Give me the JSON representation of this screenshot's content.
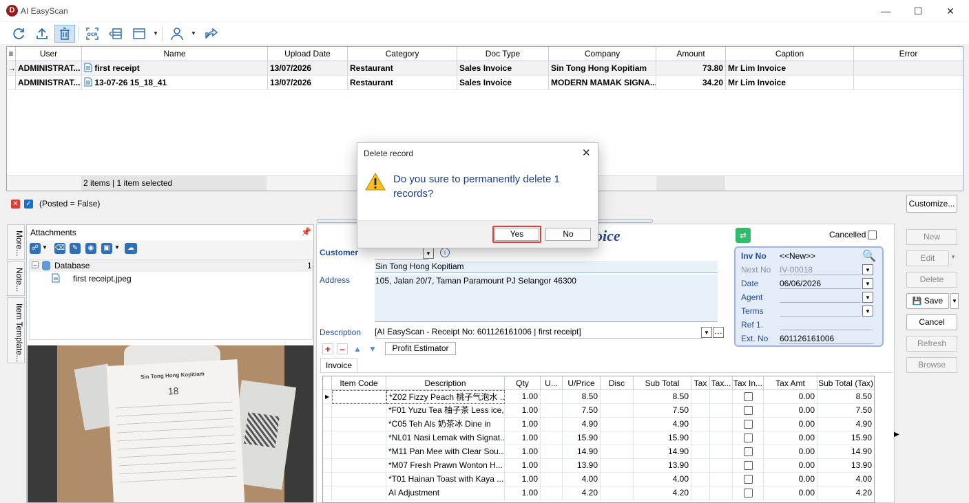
{
  "app": {
    "title": "AI EasyScan",
    "logo_letter": "D"
  },
  "grid": {
    "columns": [
      "User",
      "Name",
      "Upload Date",
      "Category",
      "Doc Type",
      "Company",
      "Amount",
      "Caption",
      "Error"
    ],
    "rows": [
      {
        "user": "ADMINISTRAT...",
        "name": "first receipt",
        "upload_date": "13/07/2026",
        "category": "Restaurant",
        "doc_type": "Sales Invoice",
        "company": "Sin Tong Hong Kopitiam",
        "amount": "73.80",
        "caption": "Mr Lim Invoice",
        "error": ""
      },
      {
        "user": "ADMINISTRAT...",
        "name": "13-07-26 15_18_41",
        "upload_date": "13/07/2026",
        "category": "Restaurant",
        "doc_type": "Sales Invoice",
        "company": "MODERN MAMAK SIGNA...",
        "amount": "34.20",
        "caption": "Mr Lim Invoice",
        "error": ""
      }
    ],
    "footer": "2 items |  1 item selected"
  },
  "filter": {
    "text": "(Posted = False)",
    "customize_label": "Customize..."
  },
  "side_tabs": [
    "More...",
    "Note...",
    "Item Template..."
  ],
  "attachments": {
    "title": "Attachments",
    "tree": {
      "root": "Database",
      "count": "1",
      "file": "first receipt.jpeg"
    }
  },
  "form": {
    "title_partial": "oice",
    "customer_label": "Customer",
    "customer_name": "Sin Tong Hong Kopitiam",
    "address_label": "Address",
    "address": "105, Jalan 20/7, Taman Paramount PJ Selangor 46300",
    "description_label": "Description",
    "description": "[AI EasyScan - Receipt No: 601126161006 | first receipt]",
    "profit_estimator": "Profit Estimator",
    "cancelled_label": "Cancelled",
    "tab_invoice": "Invoice",
    "inv": {
      "inv_no_label": "Inv No",
      "inv_no": "<<New>>",
      "next_no_label": "Next No",
      "next_no": "IV-00018",
      "date_label": "Date",
      "date": "06/06/2026",
      "agent_label": "Agent",
      "agent": "",
      "terms_label": "Terms",
      "terms": "",
      "ref_label": "Ref 1.",
      "ref": "",
      "ext_label": "Ext. No",
      "ext": "601126161006"
    }
  },
  "side_buttons": {
    "new": "New",
    "edit": "Edit",
    "delete": "Delete",
    "save": "Save",
    "cancel": "Cancel",
    "refresh": "Refresh",
    "browse": "Browse"
  },
  "items": {
    "columns": [
      "Item Code",
      "Description",
      "Qty",
      "U...",
      "U/Price",
      "Disc",
      "Sub Total",
      "Tax",
      "Tax...",
      "Tax In...",
      "Tax Amt",
      "Sub Total (Tax)"
    ],
    "rows": [
      {
        "desc": "*Z02 Fizzy Peach 桃子气泡水 ...",
        "qty": "1.00",
        "price": "8.50",
        "sub": "8.50",
        "taxamt": "0.00",
        "subtax": "8.50"
      },
      {
        "desc": "*F01 Yuzu Tea 柚子茶 Less ice,...",
        "qty": "1.00",
        "price": "7.50",
        "sub": "7.50",
        "taxamt": "0.00",
        "subtax": "7.50"
      },
      {
        "desc": "*C05 Teh Als 奶茶冰 Dine in",
        "qty": "1.00",
        "price": "4.90",
        "sub": "4.90",
        "taxamt": "0.00",
        "subtax": "4.90"
      },
      {
        "desc": "*NL01 Nasi Lemak with Signat...",
        "qty": "1.00",
        "price": "15.90",
        "sub": "15.90",
        "taxamt": "0.00",
        "subtax": "15.90"
      },
      {
        "desc": "*M11 Pan Mee with Clear Sou...",
        "qty": "1.00",
        "price": "14.90",
        "sub": "14.90",
        "taxamt": "0.00",
        "subtax": "14.90"
      },
      {
        "desc": "*M07 Fresh Prawn Wonton H...",
        "qty": "1.00",
        "price": "13.90",
        "sub": "13.90",
        "taxamt": "0.00",
        "subtax": "13.90"
      },
      {
        "desc": "*T01 Hainan Toast with Kaya ...",
        "qty": "1.00",
        "price": "4.00",
        "sub": "4.00",
        "taxamt": "0.00",
        "subtax": "4.00"
      },
      {
        "desc": "AI Adjustment",
        "qty": "1.00",
        "price": "4.20",
        "sub": "4.20",
        "taxamt": "0.00",
        "subtax": "4.20"
      }
    ]
  },
  "dialog": {
    "title": "Delete record",
    "message": "Do you sure to permanently delete 1 records?",
    "yes": "Yes",
    "no": "No"
  },
  "receipt": {
    "store": "Sin Tong Hong Kopitiam",
    "table": "18"
  }
}
